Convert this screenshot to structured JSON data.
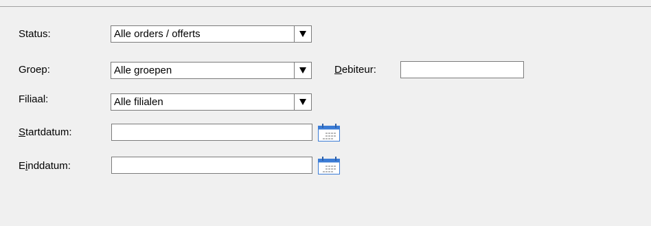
{
  "form": {
    "status": {
      "label": "Status:",
      "selected": "Alle orders / offerts"
    },
    "groep": {
      "label": "Groep:",
      "selected": "Alle groepen"
    },
    "debiteur": {
      "label_mnemonic": "D",
      "label_rest": "ebiteur:",
      "value": ""
    },
    "filiaal": {
      "label": "Filiaal:",
      "selected": "Alle filialen"
    },
    "startdatum": {
      "label_mnemonic": "S",
      "label_rest": "tartdatum:",
      "value": ""
    },
    "einddatum": {
      "label_pre": "E",
      "label_mnemonic": "i",
      "label_rest": "nddatum:",
      "value": ""
    }
  },
  "icons": {
    "dropdown_arrow": "chevron-down-icon",
    "date_picker": "calendar-icon"
  },
  "colors": {
    "background": "#f0f0f0",
    "field_border": "#7a7a7a",
    "calendar_accent": "#3a7bd5"
  }
}
